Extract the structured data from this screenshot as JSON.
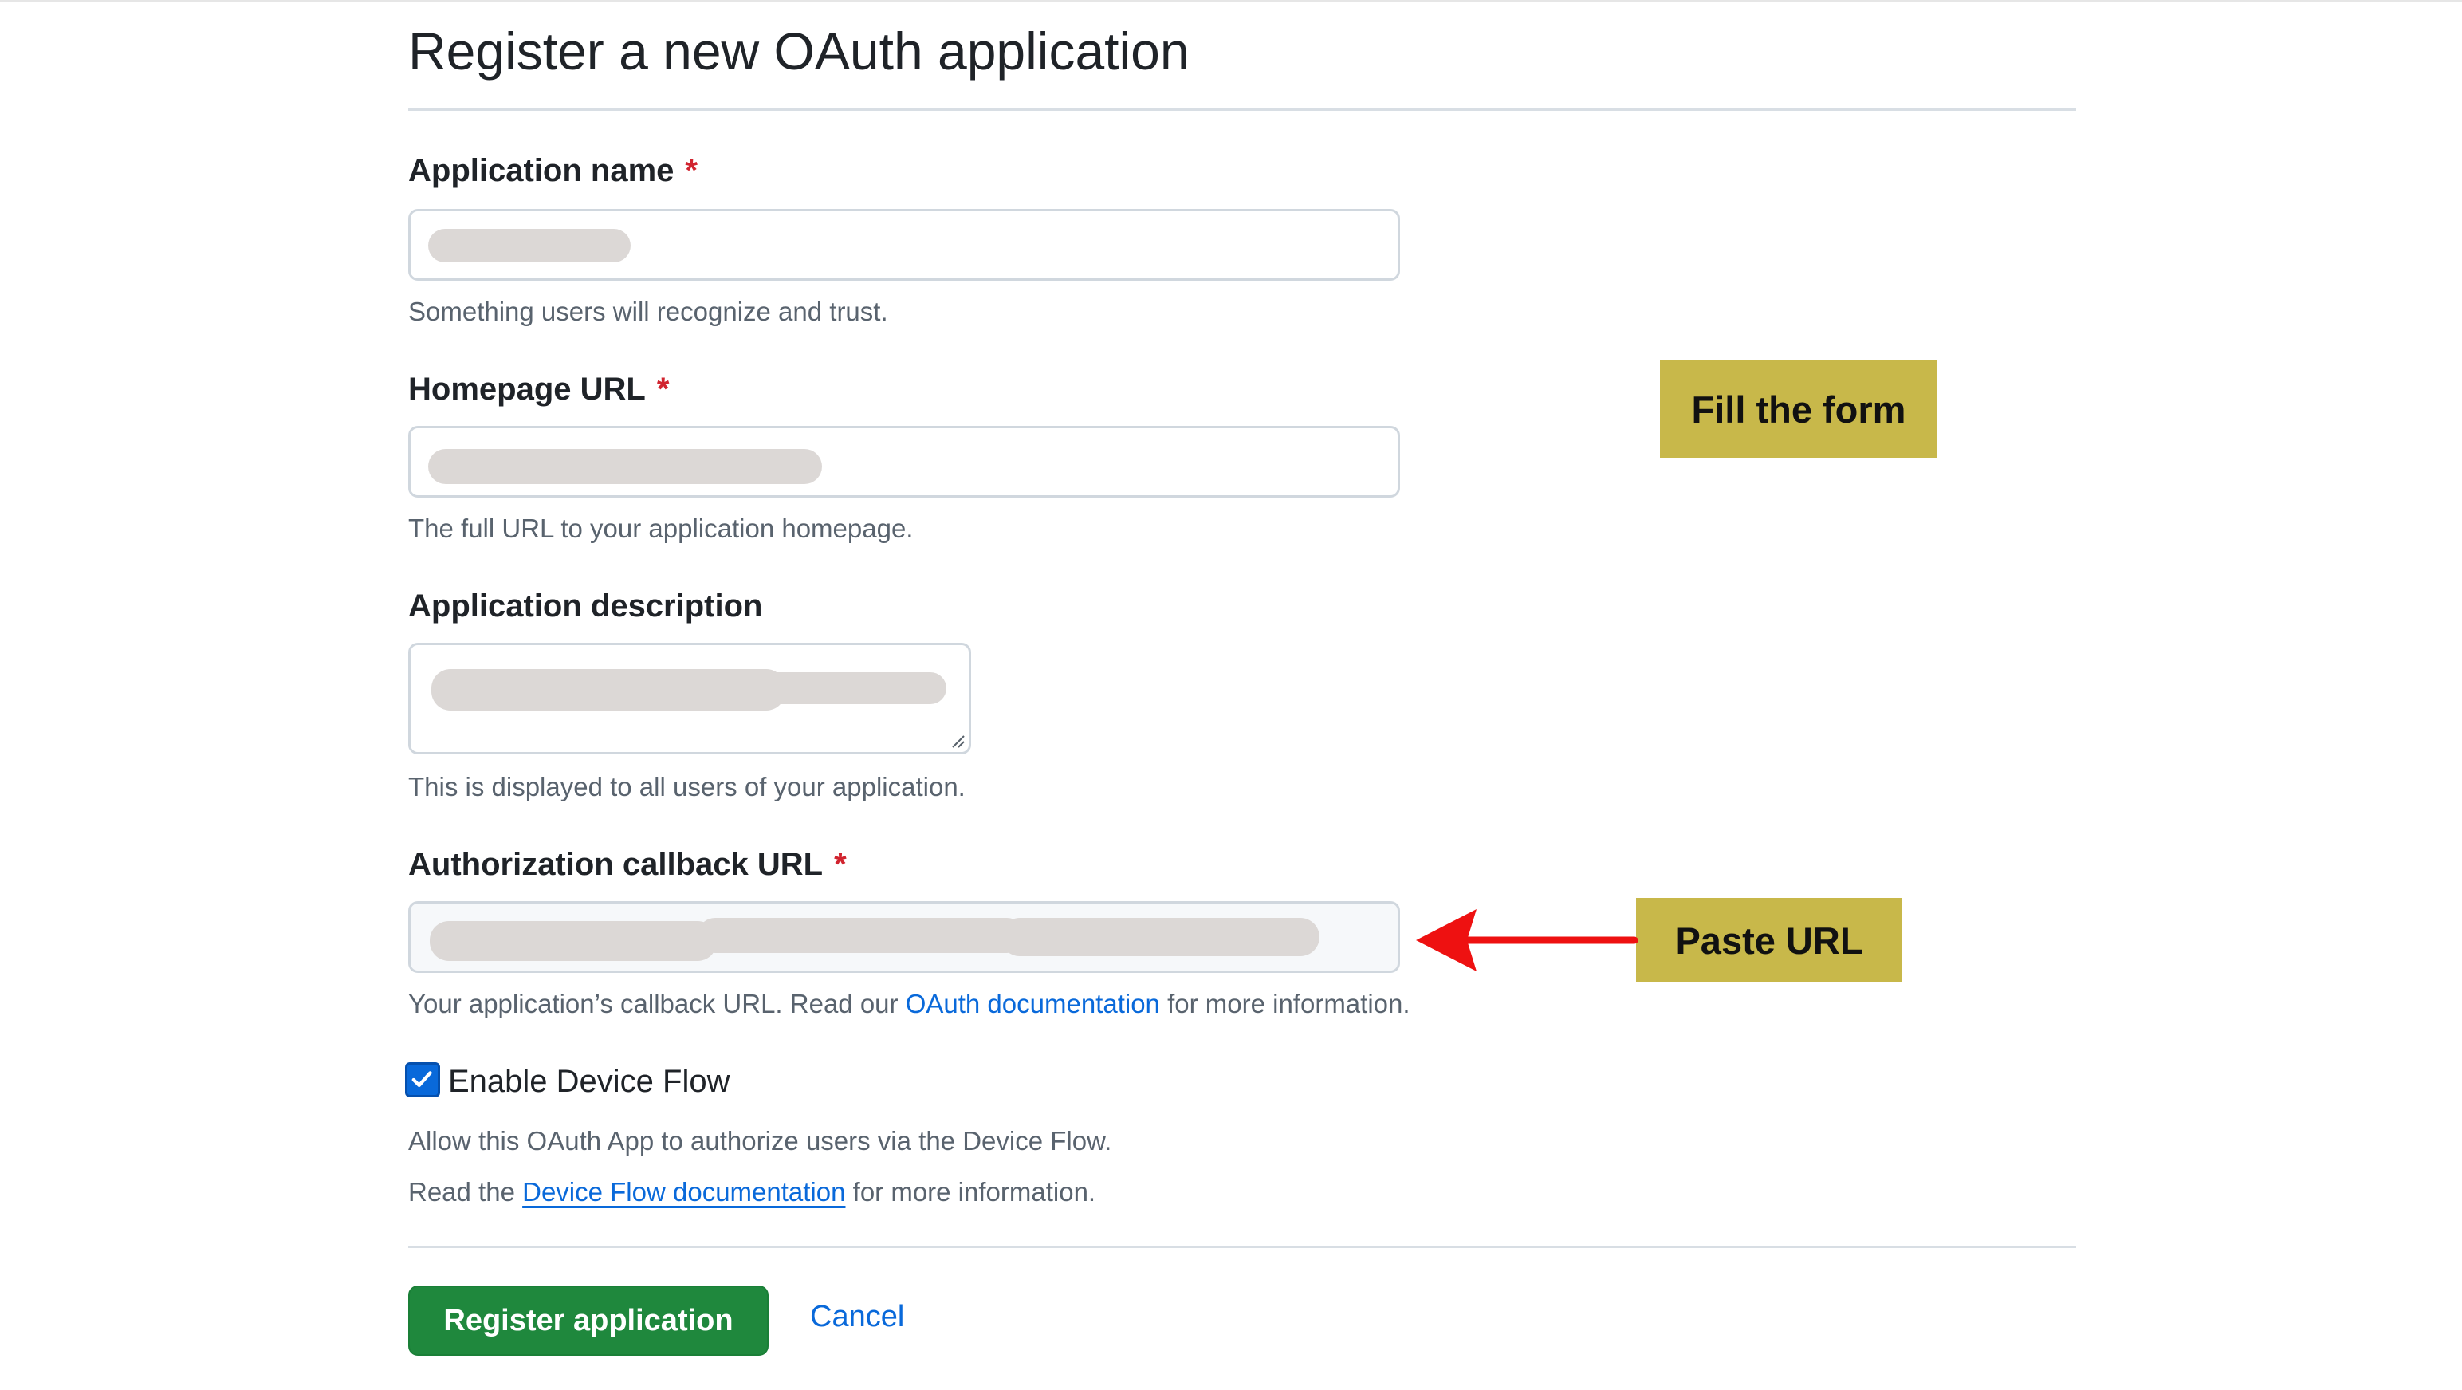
{
  "page": {
    "title": "Register a new OAuth application"
  },
  "form": {
    "application_name": {
      "label": "Application name",
      "required_mark": "*",
      "hint": "Something users will recognize and trust."
    },
    "homepage_url": {
      "label": "Homepage URL",
      "required_mark": "*",
      "hint": "The full URL to your application homepage."
    },
    "application_description": {
      "label": "Application description",
      "hint": "This is displayed to all users of your application."
    },
    "callback_url": {
      "label": "Authorization callback URL",
      "required_mark": "*",
      "hint_prefix": "Your application’s callback URL. Read our ",
      "hint_link": "OAuth documentation",
      "hint_suffix": " for more information."
    },
    "device_flow": {
      "label": "Enable Device Flow",
      "checked": true,
      "hint_line1": "Allow this OAuth App to authorize users via the Device Flow.",
      "hint_line2_prefix": "Read the ",
      "hint_line2_link": "Device Flow documentation",
      "hint_line2_suffix": " for more information."
    }
  },
  "actions": {
    "register_label": "Register application",
    "cancel_label": "Cancel"
  },
  "annotations": {
    "fill_form": "Fill the form",
    "paste_url": "Paste URL"
  },
  "colors": {
    "primary_button": "#1f883d",
    "link": "#0969da",
    "required": "#d1242f",
    "annotation_bg": "#c8b84a",
    "arrow": "#ee1111"
  }
}
